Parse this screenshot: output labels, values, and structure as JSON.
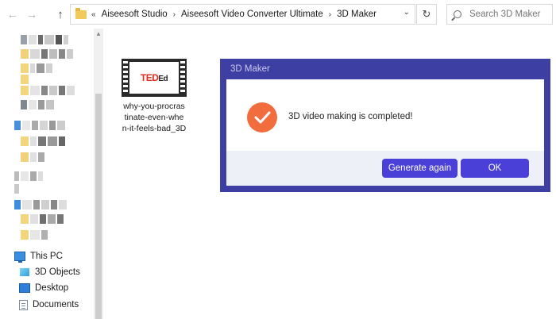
{
  "navigation": {
    "back_glyph": "←",
    "forward_glyph": "→",
    "up_glyph": "↑",
    "overflow": "«",
    "breadcrumbs": [
      "Aiseesoft Studio",
      "Aiseesoft Video Converter Ultimate",
      "3D Maker"
    ],
    "dropdown_glyph": "⌄",
    "refresh_glyph": "↻"
  },
  "search": {
    "placeholder": "Search 3D Maker"
  },
  "sidebar": {
    "items": [
      {
        "label": "This PC",
        "icon": "pc-icon"
      },
      {
        "label": "3D Objects",
        "icon": "3d-objects-icon"
      },
      {
        "label": "Desktop",
        "icon": "desktop-icon"
      },
      {
        "label": "Documents",
        "icon": "documents-icon"
      }
    ]
  },
  "file": {
    "name_line1": "why-you-procras",
    "name_line2": "tinate-even-whe",
    "name_line3": "n-it-feels-bad_3D",
    "thumbnail_brand": "TED",
    "thumbnail_suffix": "Ed"
  },
  "dialog": {
    "title": "3D Maker",
    "message": "3D video making is completed!",
    "generate_again_label": "Generate again",
    "ok_label": "OK",
    "accent_color": "#3e3fa3",
    "button_color": "#4a3fd6",
    "success_color": "#f26d3d"
  }
}
